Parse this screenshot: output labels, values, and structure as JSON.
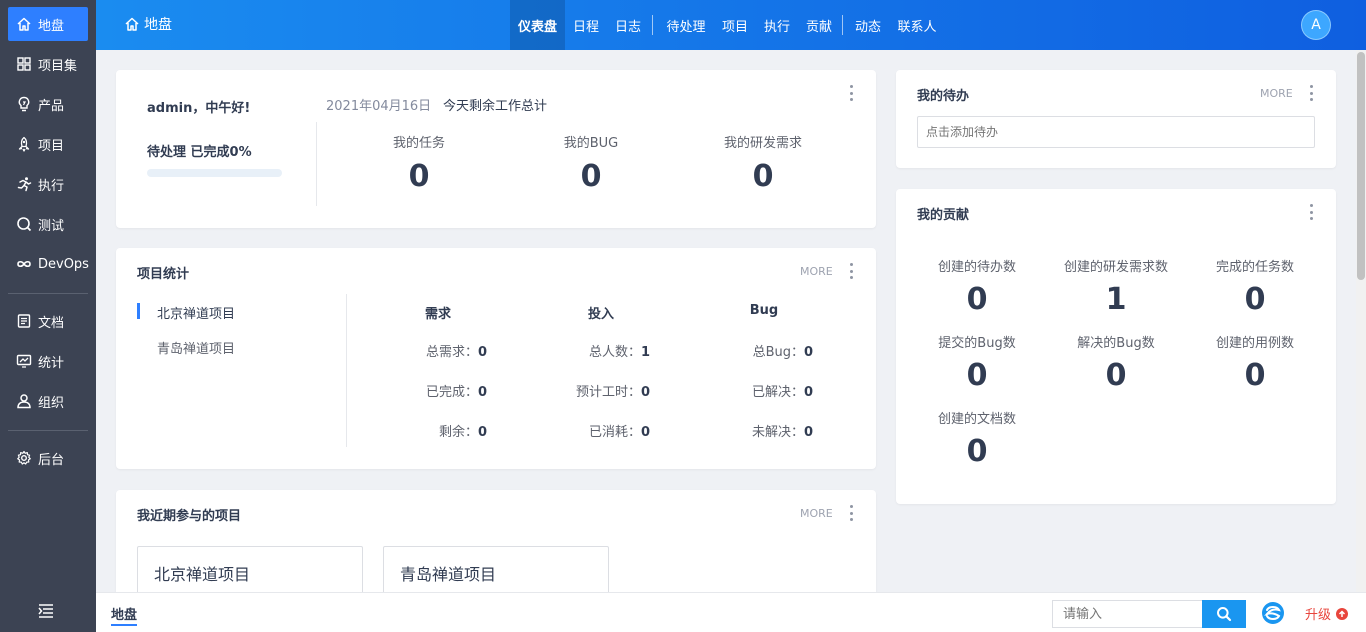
{
  "sidebar": {
    "items": [
      {
        "label": "地盘",
        "icon": "home-icon"
      },
      {
        "label": "项目集",
        "icon": "grid-icon"
      },
      {
        "label": "产品",
        "icon": "bulb-icon"
      },
      {
        "label": "项目",
        "icon": "rocket-icon"
      },
      {
        "label": "执行",
        "icon": "run-icon"
      },
      {
        "label": "测试",
        "icon": "magnifier-icon"
      },
      {
        "label": "DevOps",
        "icon": "infinity-icon"
      },
      {
        "label": "文档",
        "icon": "doc-icon"
      },
      {
        "label": "统计",
        "icon": "chart-icon"
      },
      {
        "label": "组织",
        "icon": "user-icon"
      },
      {
        "label": "后台",
        "icon": "gear-icon"
      }
    ]
  },
  "header": {
    "home_label": "地盘",
    "nav": [
      "仪表盘",
      "日程",
      "日志",
      "待处理",
      "项目",
      "执行",
      "贡献",
      "动态",
      "联系人"
    ],
    "avatar": "A"
  },
  "welcome": {
    "greeting": "admin，中午好!",
    "progress_text": "待处理 已完成0%",
    "progress": 0,
    "date": "2021年04月16日",
    "summary": "今天剩余工作总计",
    "stats": [
      {
        "label": "我的任务",
        "value": "0"
      },
      {
        "label": "我的BUG",
        "value": "0"
      },
      {
        "label": "我的研发需求",
        "value": "0"
      }
    ]
  },
  "project_stats": {
    "title": "项目统计",
    "more": "MORE",
    "projects": [
      "北京禅道项目",
      "青岛禅道项目"
    ],
    "columns": [
      {
        "head": "需求",
        "rows": [
          {
            "k": "总需求：",
            "v": "0"
          },
          {
            "k": "已完成：",
            "v": "0"
          },
          {
            "k": "剩余：",
            "v": "0"
          }
        ]
      },
      {
        "head": "投入",
        "rows": [
          {
            "k": "总人数：",
            "v": "1"
          },
          {
            "k": "预计工时：",
            "v": "0"
          },
          {
            "k": "已消耗：",
            "v": "0"
          }
        ]
      },
      {
        "head": "Bug",
        "rows": [
          {
            "k": "总Bug：",
            "v": "0"
          },
          {
            "k": "已解决：",
            "v": "0"
          },
          {
            "k": "未解决：",
            "v": "0"
          }
        ]
      }
    ]
  },
  "recent": {
    "title": "我近期参与的项目",
    "more": "MORE",
    "projects": [
      "北京禅道项目",
      "青岛禅道项目"
    ]
  },
  "todo": {
    "title": "我的待办",
    "more": "MORE",
    "placeholder": "点击添加待办"
  },
  "contrib": {
    "title": "我的贡献",
    "items": [
      {
        "label": "创建的待办数",
        "value": "0"
      },
      {
        "label": "创建的研发需求数",
        "value": "1"
      },
      {
        "label": "完成的任务数",
        "value": "0"
      },
      {
        "label": "提交的Bug数",
        "value": "0"
      },
      {
        "label": "解决的Bug数",
        "value": "0"
      },
      {
        "label": "创建的用例数",
        "value": "0"
      },
      {
        "label": "创建的文档数",
        "value": "0"
      }
    ]
  },
  "footer": {
    "tab": "地盘",
    "search_placeholder": "请输入",
    "upgrade": "升级"
  },
  "colors": {
    "accent": "#2e7fff",
    "sidebar": "#3c4353",
    "header_start": "#1a8cf0",
    "header_end": "#0f5fe0",
    "upgrade": "#e8453c"
  }
}
